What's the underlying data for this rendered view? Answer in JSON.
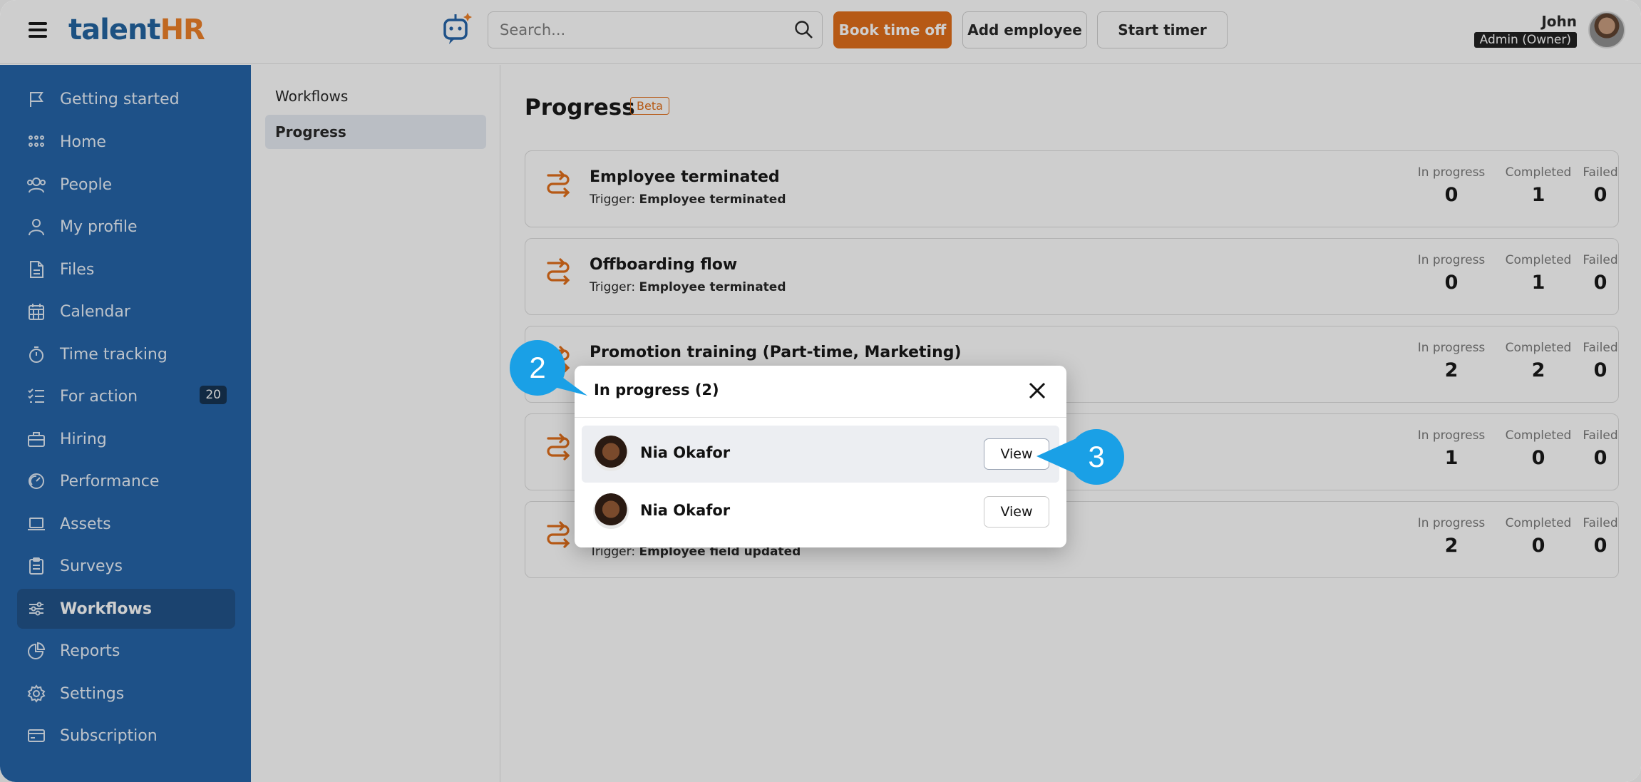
{
  "topbar": {
    "logo_main": "talent",
    "logo_accent": "HR",
    "search_placeholder": "Search...",
    "book_time_off": "Book time off",
    "add_employee": "Add employee",
    "start_timer": "Start timer",
    "user_name": "John",
    "user_role": "Admin (Owner)"
  },
  "sidebar": {
    "items": [
      {
        "label": "Getting started",
        "icon": "flag-icon"
      },
      {
        "label": "Home",
        "icon": "grid-icon"
      },
      {
        "label": "People",
        "icon": "people-icon"
      },
      {
        "label": "My profile",
        "icon": "user-icon"
      },
      {
        "label": "Files",
        "icon": "file-icon"
      },
      {
        "label": "Calendar",
        "icon": "calendar-icon"
      },
      {
        "label": "Time tracking",
        "icon": "stopwatch-icon"
      },
      {
        "label": "For action",
        "icon": "checklist-icon",
        "badge": "20"
      },
      {
        "label": "Hiring",
        "icon": "briefcase-icon"
      },
      {
        "label": "Performance",
        "icon": "gauge-icon"
      },
      {
        "label": "Assets",
        "icon": "laptop-icon"
      },
      {
        "label": "Surveys",
        "icon": "clipboard-icon"
      },
      {
        "label": "Workflows",
        "icon": "workflow-icon",
        "active": true
      },
      {
        "label": "Reports",
        "icon": "pie-chart-icon"
      },
      {
        "label": "Settings",
        "icon": "gear-icon"
      },
      {
        "label": "Subscription",
        "icon": "credit-card-icon"
      }
    ]
  },
  "subnav": {
    "items": [
      {
        "label": "Workflows"
      },
      {
        "label": "Progress",
        "active": true
      }
    ]
  },
  "main": {
    "title": "Progress",
    "beta": "Beta",
    "stat_labels": {
      "in_progress": "In progress",
      "completed": "Completed",
      "failed": "Failed"
    },
    "trigger_prefix": "Trigger:",
    "cards": [
      {
        "title": "Employee terminated",
        "trigger": "Employee terminated",
        "in_progress": "0",
        "completed": "1",
        "failed": "0"
      },
      {
        "title": "Offboarding flow",
        "trigger": "Employee terminated",
        "in_progress": "0",
        "completed": "1",
        "failed": "0"
      },
      {
        "title": "Promotion training (Part-time, Marketing)",
        "trigger": "",
        "in_progress": "2",
        "completed": "2",
        "failed": "0"
      },
      {
        "title": "",
        "trigger": "",
        "in_progress": "1",
        "completed": "0",
        "failed": "0"
      },
      {
        "title": "",
        "trigger": "Employee field updated",
        "in_progress": "2",
        "completed": "0",
        "failed": "0"
      }
    ]
  },
  "modal": {
    "title": "In progress (2)",
    "rows": [
      {
        "name": "Nia Okafor",
        "action": "View"
      },
      {
        "name": "Nia Okafor",
        "action": "View"
      }
    ]
  },
  "callouts": {
    "first": "2",
    "second": "3"
  },
  "colors": {
    "brand_blue": "#1e5fa6",
    "accent_orange": "#e06a12",
    "callout_blue": "#1aa0e6"
  }
}
